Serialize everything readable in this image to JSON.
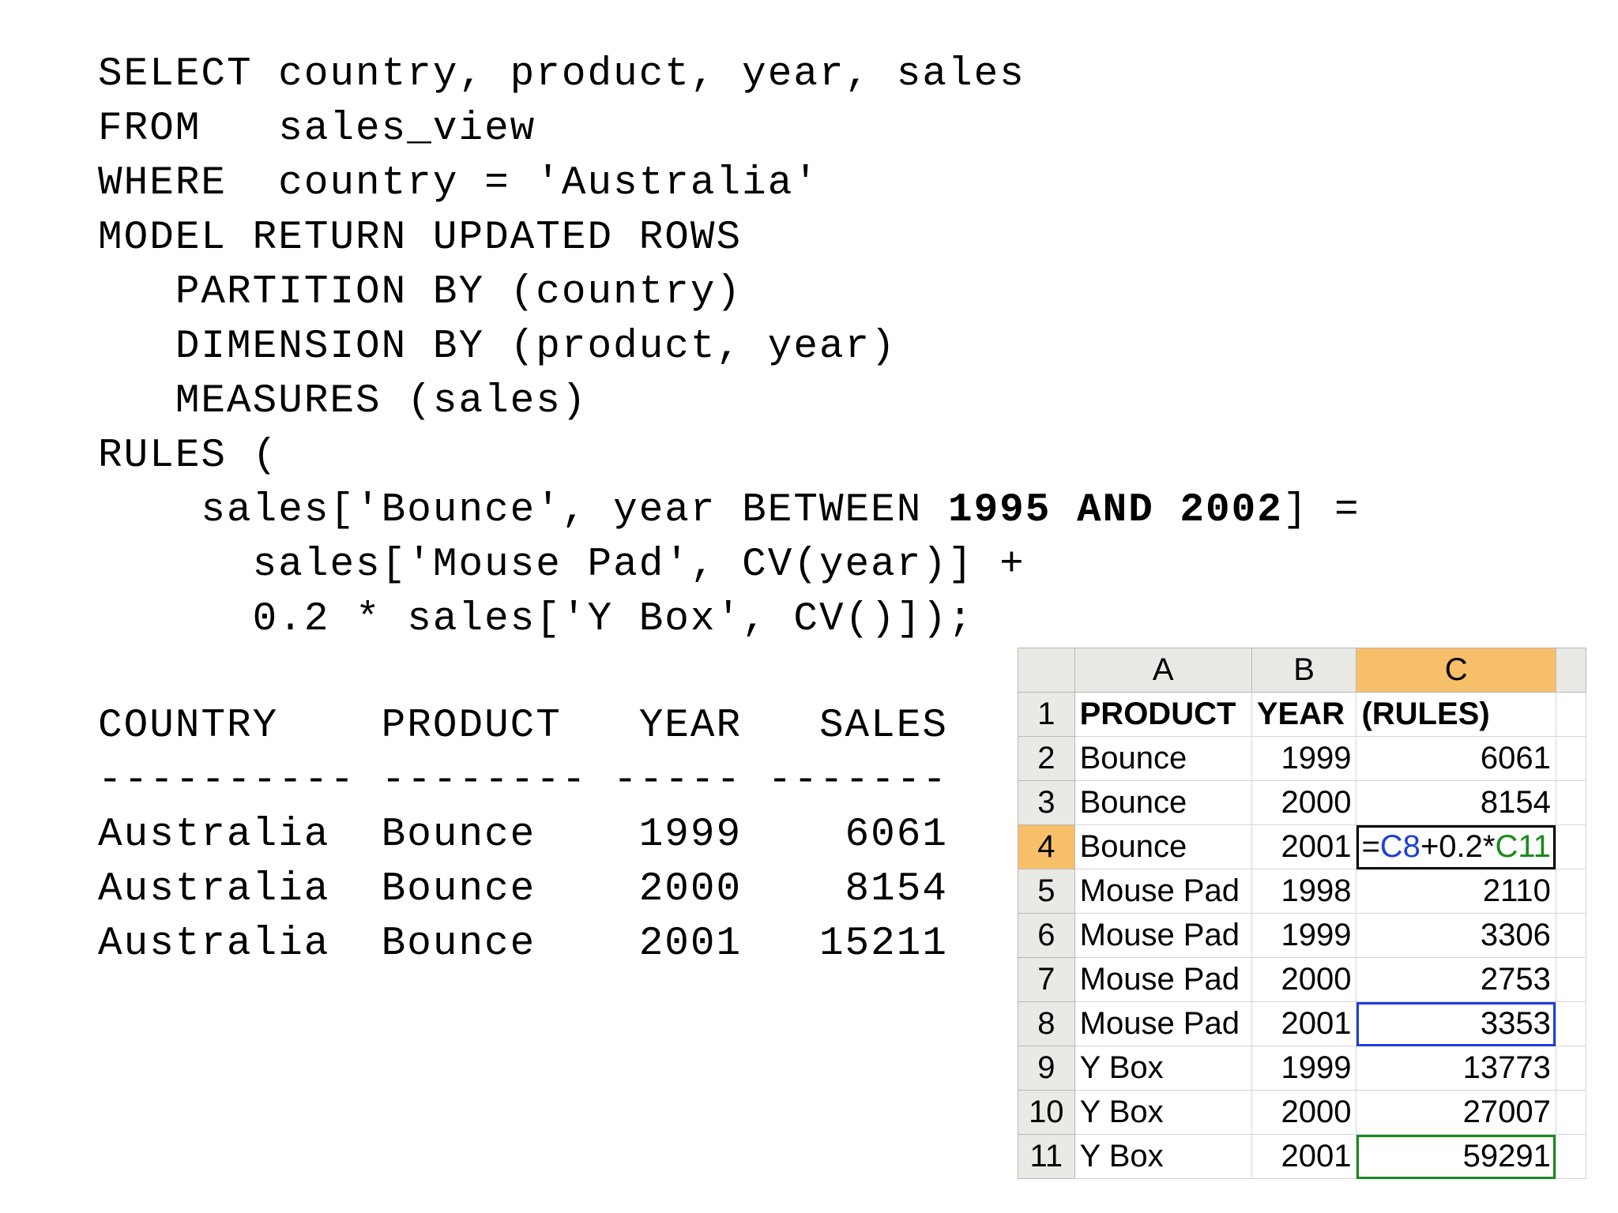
{
  "sql": {
    "l1": "SELECT country, product, year, sales",
    "l2": "FROM   sales_view",
    "l3": "WHERE  country = 'Australia'",
    "l4": "MODEL RETURN UPDATED ROWS",
    "l5": "   PARTITION BY (country)",
    "l6": "   DIMENSION BY (product, year)",
    "l7": "   MEASURES (sales)",
    "l8": "RULES (",
    "l9_pre": "    sales['Bounce', year BETWEEN ",
    "l9_bold": "1995 AND 2002",
    "l9_post": "] =",
    "l10": "      sales['Mouse Pad', CV(year)] +",
    "l11": "      0.2 * sales['Y Box', CV()]);"
  },
  "result": {
    "header": "COUNTRY    PRODUCT   YEAR   SALES",
    "divider": "---------- -------- ----- -------",
    "rows": [
      "Australia  Bounce    1999    6061",
      "Australia  Bounce    2000    8154",
      "Australia  Bounce    2001   15211"
    ]
  },
  "sheet": {
    "columns": [
      "A",
      "B",
      "C"
    ],
    "rows": [
      {
        "n": "1",
        "a": "PRODUCT",
        "b": "YEAR",
        "c": "(RULES)"
      },
      {
        "n": "2",
        "a": "Bounce",
        "b": "1999",
        "c": "6061"
      },
      {
        "n": "3",
        "a": "Bounce",
        "b": "2000",
        "c": "8154"
      },
      {
        "n": "4",
        "a": "Bounce",
        "b": "2001",
        "c": ""
      },
      {
        "n": "5",
        "a": "Mouse Pad",
        "b": "1998",
        "c": "2110"
      },
      {
        "n": "6",
        "a": "Mouse Pad",
        "b": "1999",
        "c": "3306"
      },
      {
        "n": "7",
        "a": "Mouse Pad",
        "b": "2000",
        "c": "2753"
      },
      {
        "n": "8",
        "a": "Mouse Pad",
        "b": "2001",
        "c": "3353"
      },
      {
        "n": "9",
        "a": "Y Box",
        "b": "1999",
        "c": "13773"
      },
      {
        "n": "10",
        "a": "Y Box",
        "b": "2000",
        "c": "27007"
      },
      {
        "n": "11",
        "a": "Y Box",
        "b": "2001",
        "c": "59291"
      }
    ],
    "formula": {
      "eq": "=",
      "ref1": "C8",
      "mid": "+0.2*",
      "ref2": "C11"
    },
    "colors": {
      "header_bg": "#e9e9e5",
      "selected_header": "#f7bf6a",
      "ref_blue": "#1f3fdc",
      "ref_green": "#1a8a1a"
    }
  }
}
